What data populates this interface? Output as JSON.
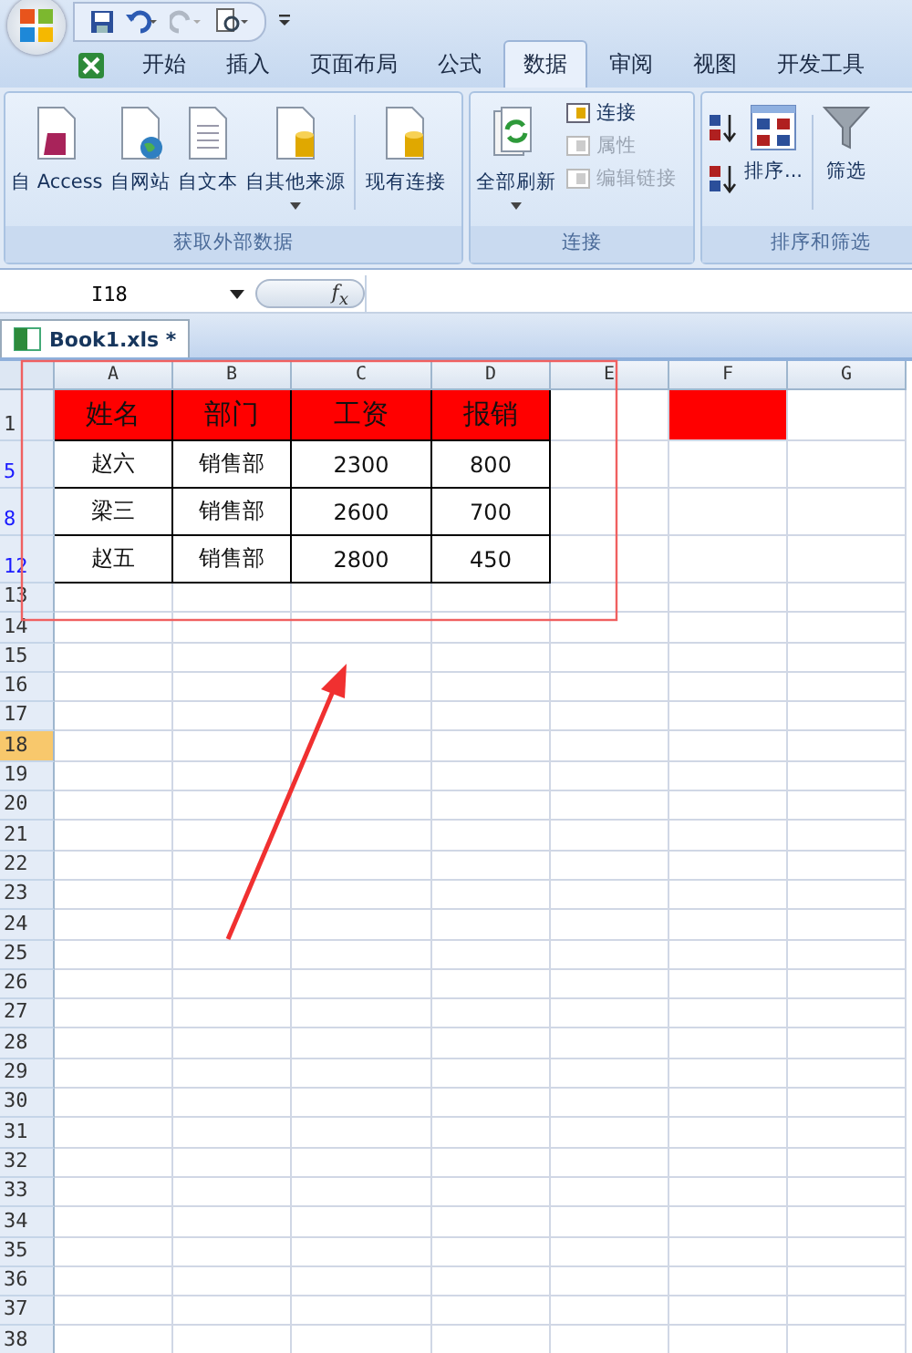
{
  "ribbon_tabs": [
    {
      "label": "开始",
      "selected": false
    },
    {
      "label": "插入",
      "selected": false
    },
    {
      "label": "页面布局",
      "selected": false
    },
    {
      "label": "公式",
      "selected": false
    },
    {
      "label": "数据",
      "selected": true
    },
    {
      "label": "审阅",
      "selected": false
    },
    {
      "label": "视图",
      "selected": false
    },
    {
      "label": "开发工具",
      "selected": false
    }
  ],
  "groups": [
    {
      "title": "获取外部数据",
      "buttons": [
        {
          "label": "自 Access",
          "kind": "access",
          "dropdown": false,
          "separated": false
        },
        {
          "label": "自网站",
          "kind": "web",
          "dropdown": false,
          "separated": false
        },
        {
          "label": "自文本",
          "kind": "text",
          "dropdown": false,
          "separated": false
        },
        {
          "label": "自其他来源",
          "kind": "database",
          "dropdown": true,
          "separated": false
        },
        {
          "label": "现有连接",
          "kind": "database",
          "dropdown": false,
          "separated": true
        }
      ]
    },
    {
      "title": "连接",
      "buttons": [
        {
          "label": "全部刷新",
          "kind": "refresh",
          "dropdown": true
        }
      ],
      "small_buttons": [
        {
          "label": "连接",
          "disabled": false
        },
        {
          "label": "属性",
          "disabled": true
        },
        {
          "label": "编辑链接",
          "disabled": true
        }
      ]
    },
    {
      "title": "排序和筛选",
      "sort_label": "排序...",
      "filter_label": "筛选"
    }
  ],
  "name_box": "I18",
  "function_button": "f$_{x}$",
  "workbook_tab": "Book1.xls *",
  "columns": [
    "A",
    "B",
    "C",
    "D",
    "E",
    "F",
    "G"
  ],
  "rows": [
    {
      "number": "1",
      "kind": "title",
      "filtered": false,
      "selected": false,
      "cells": [
        {
          "text": "姓名",
          "color": "#ff0000"
        },
        {
          "text": "部门",
          "color": "#ff0000"
        },
        {
          "text": "工资",
          "color": "#ff0000"
        },
        {
          "text": "报销",
          "color": "#ff0000"
        },
        {},
        {
          "color": "#ff0000"
        },
        {}
      ]
    },
    {
      "number": "5",
      "kind": "data",
      "filtered": true,
      "selected": false,
      "cells": [
        {
          "text": "赵六"
        },
        {
          "text": "销售部"
        },
        {
          "text": "2300"
        },
        {
          "text": "800"
        }
      ]
    },
    {
      "number": "8",
      "kind": "data",
      "filtered": true,
      "selected": false,
      "cells": [
        {
          "text": "梁三"
        },
        {
          "text": "销售部"
        },
        {
          "text": "2600"
        },
        {
          "text": "700"
        }
      ]
    },
    {
      "number": "12",
      "kind": "data",
      "filtered": true,
      "selected": false,
      "cells": [
        {
          "text": "赵五"
        },
        {
          "text": "销售部"
        },
        {
          "text": "2800"
        },
        {
          "text": "450"
        }
      ]
    },
    {
      "number": "13",
      "kind": "empty",
      "filtered": false,
      "selected": false
    },
    {
      "number": "14",
      "kind": "empty",
      "filtered": false,
      "selected": false
    },
    {
      "number": "15",
      "kind": "empty",
      "filtered": false,
      "selected": false
    },
    {
      "number": "16",
      "kind": "empty",
      "filtered": false,
      "selected": false
    },
    {
      "number": "17",
      "kind": "empty",
      "filtered": false,
      "selected": false
    },
    {
      "number": "18",
      "kind": "empty",
      "filtered": false,
      "selected": true
    },
    {
      "number": "19",
      "kind": "empty",
      "filtered": false,
      "selected": false
    },
    {
      "number": "20",
      "kind": "empty",
      "filtered": false,
      "selected": false
    },
    {
      "number": "21",
      "kind": "empty",
      "filtered": false,
      "selected": false
    },
    {
      "number": "22",
      "kind": "empty",
      "filtered": false,
      "selected": false
    },
    {
      "number": "23",
      "kind": "empty",
      "filtered": false,
      "selected": false
    },
    {
      "number": "24",
      "kind": "empty",
      "filtered": false,
      "selected": false
    },
    {
      "number": "25",
      "kind": "empty",
      "filtered": false,
      "selected": false
    },
    {
      "number": "26",
      "kind": "empty",
      "filtered": false,
      "selected": false
    },
    {
      "number": "27",
      "kind": "empty",
      "filtered": false,
      "selected": false
    },
    {
      "number": "28",
      "kind": "empty",
      "filtered": false,
      "selected": false
    },
    {
      "number": "29",
      "kind": "empty",
      "filtered": false,
      "selected": false
    },
    {
      "number": "30",
      "kind": "empty",
      "filtered": false,
      "selected": false
    },
    {
      "number": "31",
      "kind": "empty",
      "filtered": false,
      "selected": false
    },
    {
      "number": "32",
      "kind": "empty",
      "filtered": false,
      "selected": false
    },
    {
      "number": "33",
      "kind": "empty",
      "filtered": false,
      "selected": false
    },
    {
      "number": "34",
      "kind": "empty",
      "filtered": false,
      "selected": false
    },
    {
      "number": "35",
      "kind": "empty",
      "filtered": false,
      "selected": false
    },
    {
      "number": "36",
      "kind": "empty",
      "filtered": false,
      "selected": false
    },
    {
      "number": "37",
      "kind": "empty",
      "filtered": false,
      "selected": false
    },
    {
      "number": "38",
      "kind": "empty",
      "filtered": false,
      "selected": false
    }
  ]
}
